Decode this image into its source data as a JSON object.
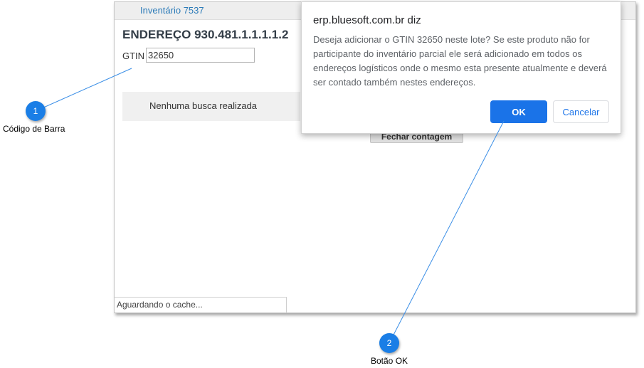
{
  "app": {
    "header_title": "Inventário 7537",
    "address_title": "ENDEREÇO 930.481.1.1.1.1.2",
    "gtin_label": "GTIN",
    "gtin_value": "32650",
    "search_status": "Nenhuma busca realizada",
    "close_count_label": "Fechar contagem",
    "status_bar": "Aguardando o cache..."
  },
  "dialog": {
    "title": "erp.bluesoft.com.br diz",
    "message": "Deseja adicionar o GTIN 32650 neste lote? Se este produto não for participante do inventário parcial ele será adicionado em todos os endereços logísticos onde o mesmo esta presente atualmente e deverá ser contado também nestes endereços.",
    "ok_label": "OK",
    "cancel_label": "Cancelar"
  },
  "callouts": [
    {
      "number": "1",
      "label": "Código de Barra"
    },
    {
      "number": "2",
      "label": "Botão OK"
    }
  ],
  "colors": {
    "accent": "#1a73e8",
    "marker": "#1a7ee6",
    "header_text": "#2a7ab8"
  }
}
